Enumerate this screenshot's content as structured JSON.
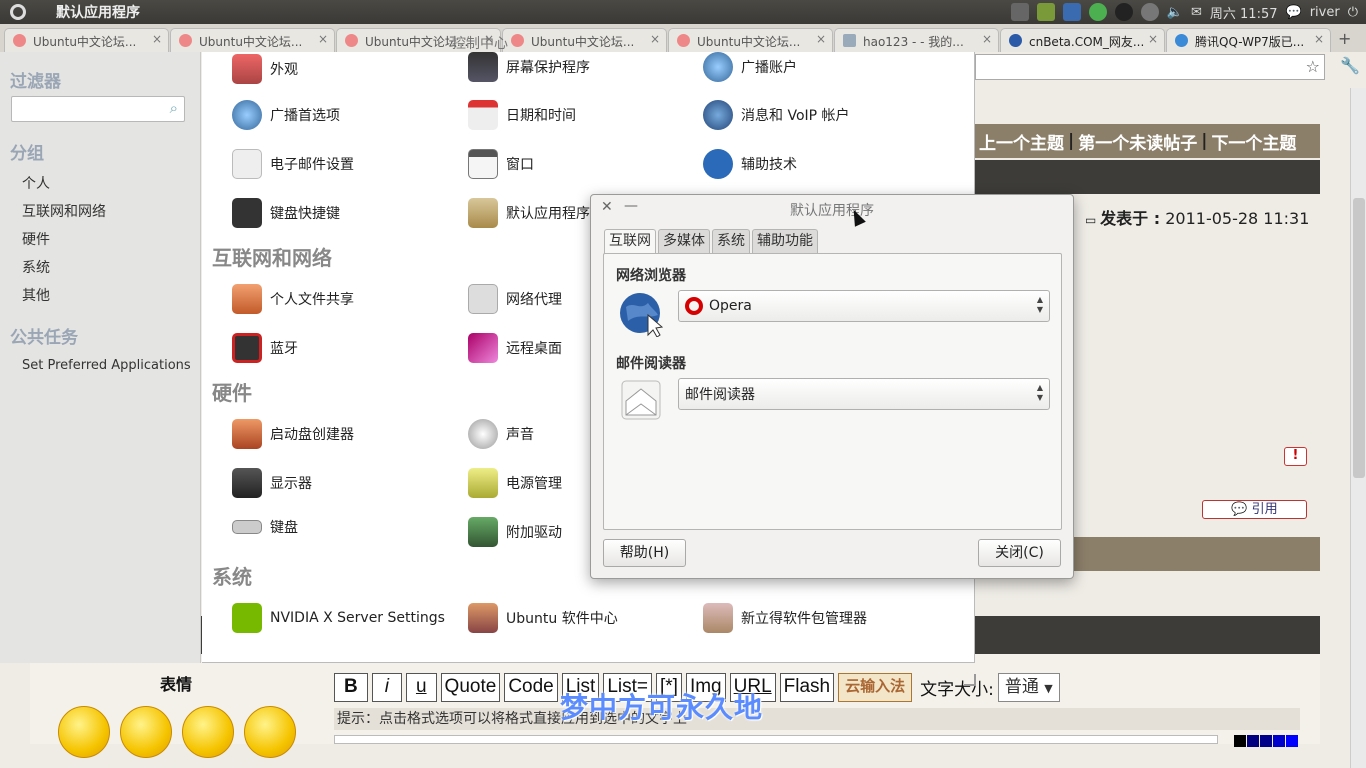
{
  "top_panel": {
    "app_title": "默认应用程序",
    "time": "周六 11:57",
    "user": "river"
  },
  "browser": {
    "tabs": [
      {
        "label": "Ubuntu中文论坛..."
      },
      {
        "label": "Ubuntu中文论坛..."
      },
      {
        "label": "Ubuntu中文论坛..."
      },
      {
        "label": "Ubuntu中文论坛..."
      },
      {
        "label": "Ubuntu中文论坛..."
      },
      {
        "label": "hao123 - - 我的..."
      },
      {
        "label": "cnBeta.COM_网友..."
      },
      {
        "label": "腾讯QQ-WP7版已..."
      }
    ],
    "forum": {
      "nav_prev": "上一个主题",
      "nav_first_unread": "第一个未读帖子",
      "nav_next": "下一个主题",
      "posted_label": "发表于 :",
      "posted_date": "2011-05-28 11:31",
      "quote_label": "引用",
      "emoji_title": "表情",
      "editor_buttons": [
        "B",
        "i",
        "u",
        "Quote",
        "Code",
        "List",
        "List=",
        "[*]",
        "Img",
        "URL",
        "Flash"
      ],
      "cloud_input": "云输入法",
      "font_size_label": "文字大小:",
      "font_size_value": "普通",
      "hint": "提示：点击格式选项可以将格式直接应用到选中的文字上",
      "watermark": "梦中方可永久地"
    }
  },
  "control_center": {
    "title": "控制中心",
    "sidebar": {
      "filter_heading": "过滤器",
      "group_heading": "分组",
      "groups": [
        "个人",
        "互联网和网络",
        "硬件",
        "系统",
        "其他"
      ],
      "tasks_heading": "公共任务",
      "tasks": [
        "Set Preferred Applications"
      ]
    },
    "sections": {
      "internet": "互联网和网络",
      "hardware": "硬件",
      "system": "系统"
    },
    "items": {
      "appearance": "外观",
      "screensaver": "屏幕保护程序",
      "broadcast_account": "广播账户",
      "broadcast_prefs": "广播首选项",
      "datetime": "日期和时间",
      "messaging_voip": "消息和 VoIP 帐户",
      "email": "电子邮件设置",
      "windows": "窗口",
      "accessibility": "辅助技术",
      "keyboard_shortcuts": "键盘快捷键",
      "default_apps": "默认应用程序",
      "file_sharing": "个人文件共享",
      "network_proxy": "网络代理",
      "bluetooth": "蓝牙",
      "remote_desktop": "远程桌面",
      "startup_disk": "启动盘创建器",
      "sound": "声音",
      "display": "显示器",
      "power": "电源管理",
      "keyboard": "键盘",
      "additional_drivers": "附加驱动",
      "nvidia": "NVIDIA X Server Settings",
      "software_center": "Ubuntu 软件中心",
      "synaptic": "新立得软件包管理器"
    }
  },
  "dialog": {
    "title": "默认应用程序",
    "tabs": [
      "互联网",
      "多媒体",
      "系统",
      "辅助功能"
    ],
    "browser_heading": "网络浏览器",
    "browser_value": "Opera",
    "mail_heading": "邮件阅读器",
    "mail_value": "邮件阅读器",
    "help_button": "帮助(H)",
    "close_button": "关闭(C)"
  }
}
